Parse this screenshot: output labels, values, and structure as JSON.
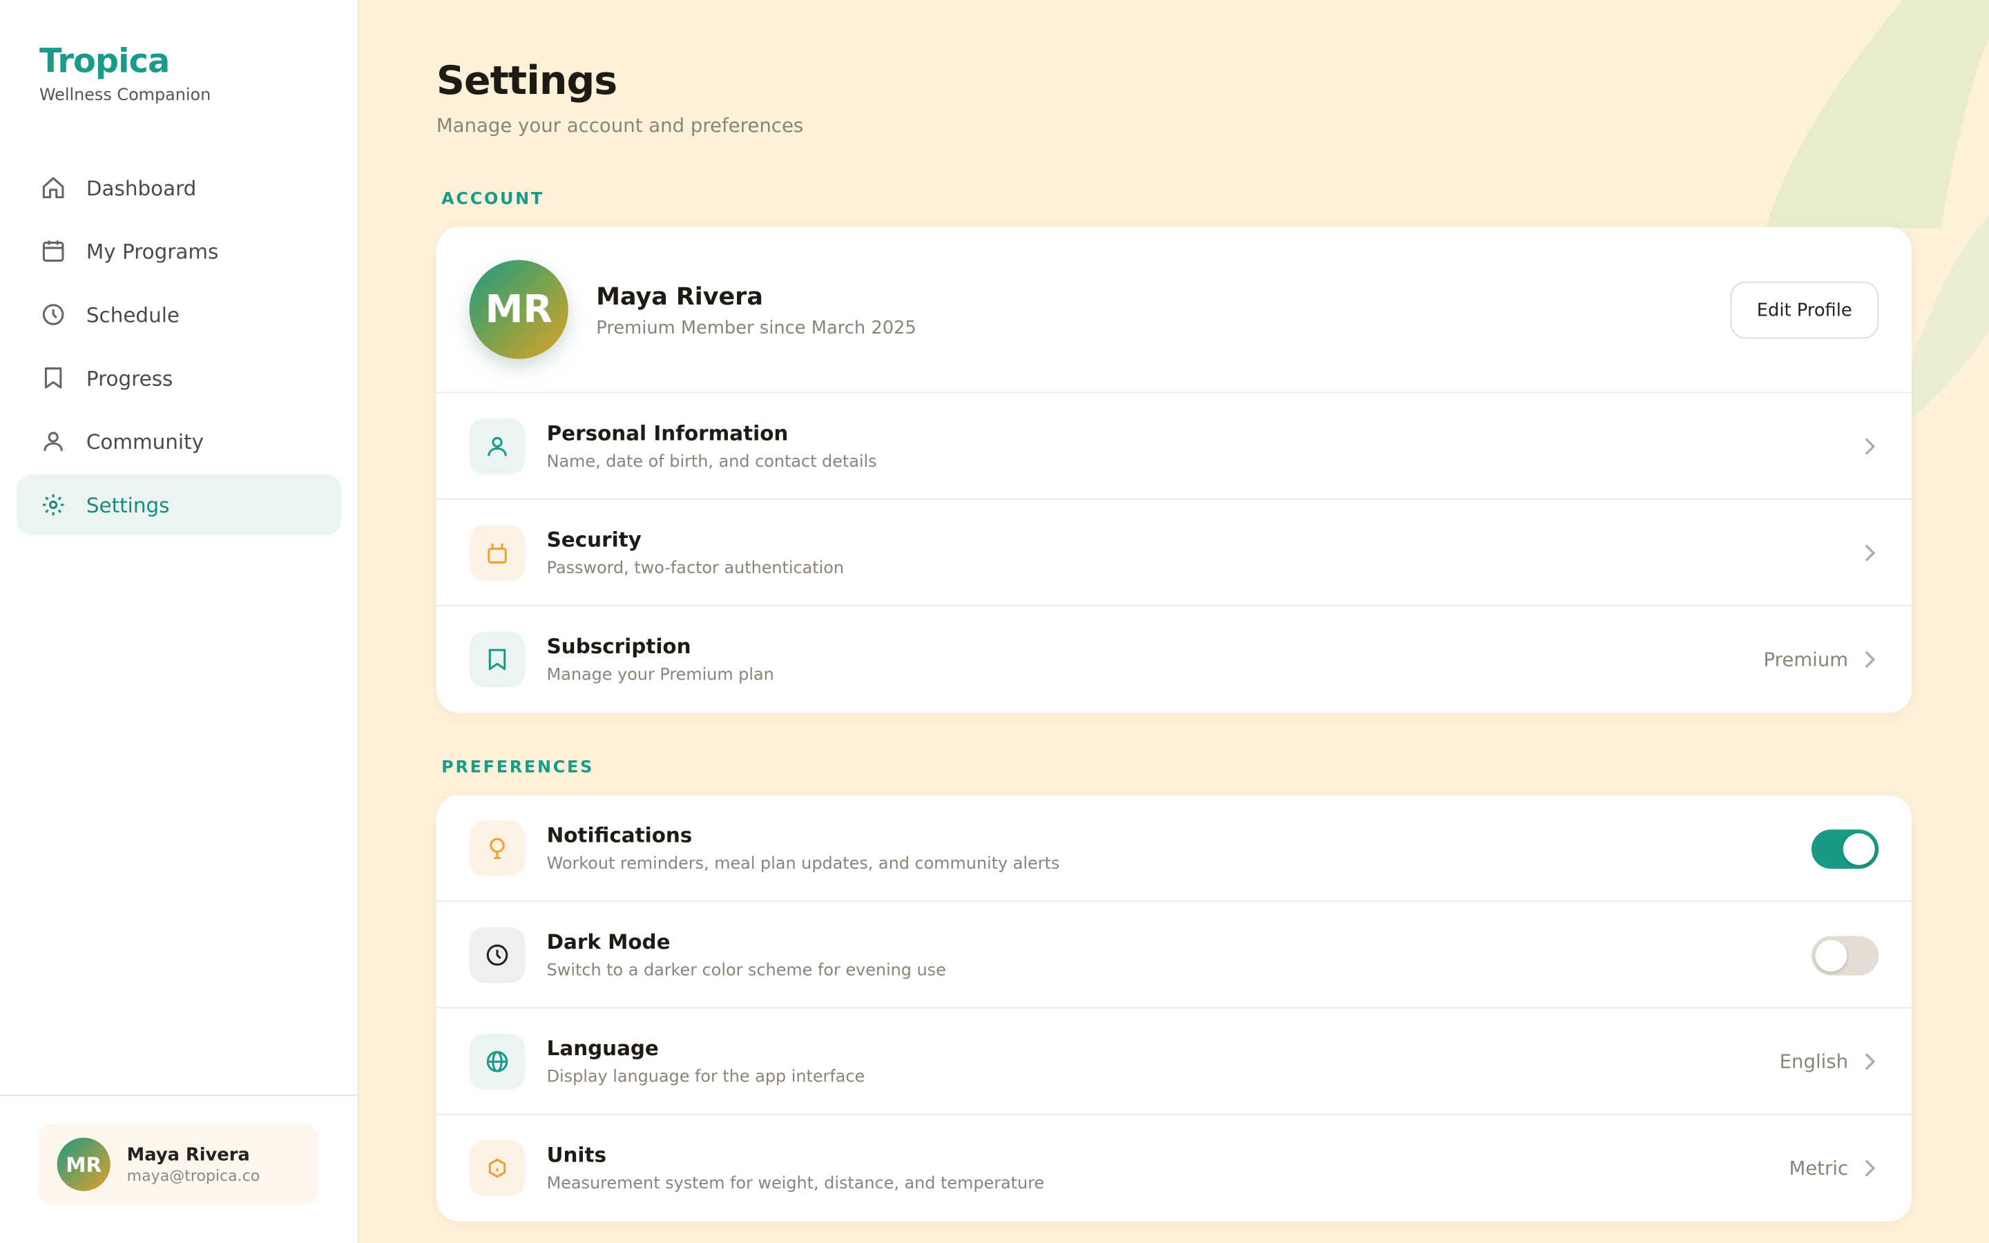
{
  "brand": {
    "name": "Tropica",
    "tagline": "Wellness Companion"
  },
  "nav": {
    "items": [
      {
        "label": "Dashboard",
        "icon": "home-icon"
      },
      {
        "label": "My Programs",
        "icon": "calendar-icon"
      },
      {
        "label": "Schedule",
        "icon": "clock-icon"
      },
      {
        "label": "Progress",
        "icon": "bookmark-icon"
      },
      {
        "label": "Community",
        "icon": "user-icon"
      },
      {
        "label": "Settings",
        "icon": "gear-icon",
        "active": true
      }
    ]
  },
  "sidebar_user": {
    "initials": "MR",
    "name": "Maya Rivera",
    "email": "maya@tropica.co"
  },
  "page": {
    "title": "Settings",
    "subtitle": "Manage your account and preferences"
  },
  "account": {
    "section_label": "ACCOUNT",
    "profile": {
      "initials": "MR",
      "name": "Maya Rivera",
      "subtitle": "Premium Member since March 2025",
      "edit_label": "Edit Profile"
    },
    "rows": [
      {
        "title": "Personal Information",
        "desc": "Name, date of birth, and contact details",
        "icon": "user-icon",
        "value": ""
      },
      {
        "title": "Security",
        "desc": "Password, two-factor authentication",
        "icon": "lock-icon",
        "value": ""
      },
      {
        "title": "Subscription",
        "desc": "Manage your Premium plan",
        "icon": "bookmark-icon",
        "value": "Premium"
      }
    ]
  },
  "preferences": {
    "section_label": "PREFERENCES",
    "rows": [
      {
        "title": "Notifications",
        "desc": "Workout reminders, meal plan updates, and community alerts",
        "icon": "bulb-icon",
        "toggle": true
      },
      {
        "title": "Dark Mode",
        "desc": "Switch to a darker color scheme for evening use",
        "icon": "clock-icon",
        "toggle": false
      },
      {
        "title": "Language",
        "desc": "Display language for the app interface",
        "icon": "globe-icon",
        "value": "English"
      },
      {
        "title": "Units",
        "desc": "Measurement system for weight, distance, and temperature",
        "icon": "cube-icon",
        "value": "Metric"
      }
    ]
  },
  "colors": {
    "accent": "#1a9a8a",
    "background": "#fdf1da",
    "orange": "#f0a030"
  }
}
